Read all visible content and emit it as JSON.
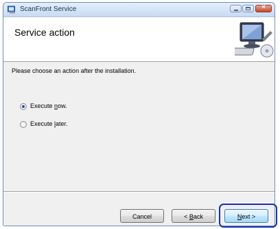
{
  "window": {
    "title": "ScanFront Service",
    "controls": [
      "minimize",
      "maximize",
      "close"
    ]
  },
  "header": {
    "title": "Service action",
    "art_icon": "computer-setup-icon"
  },
  "main": {
    "prompt": "Please choose an action after the installation.",
    "options": [
      {
        "label_pre": "Execute ",
        "label_accel": "n",
        "label_post": "ow.",
        "selected": true
      },
      {
        "label_pre": "Execute ",
        "label_accel": "l",
        "label_post": "ater.",
        "selected": false
      }
    ]
  },
  "footer": {
    "cancel": "Cancel",
    "back": {
      "pre": "< ",
      "accel": "B",
      "post": "ack"
    },
    "next": {
      "accel": "N",
      "post": "ext >"
    },
    "highlight_color": "#1a2fb0"
  }
}
